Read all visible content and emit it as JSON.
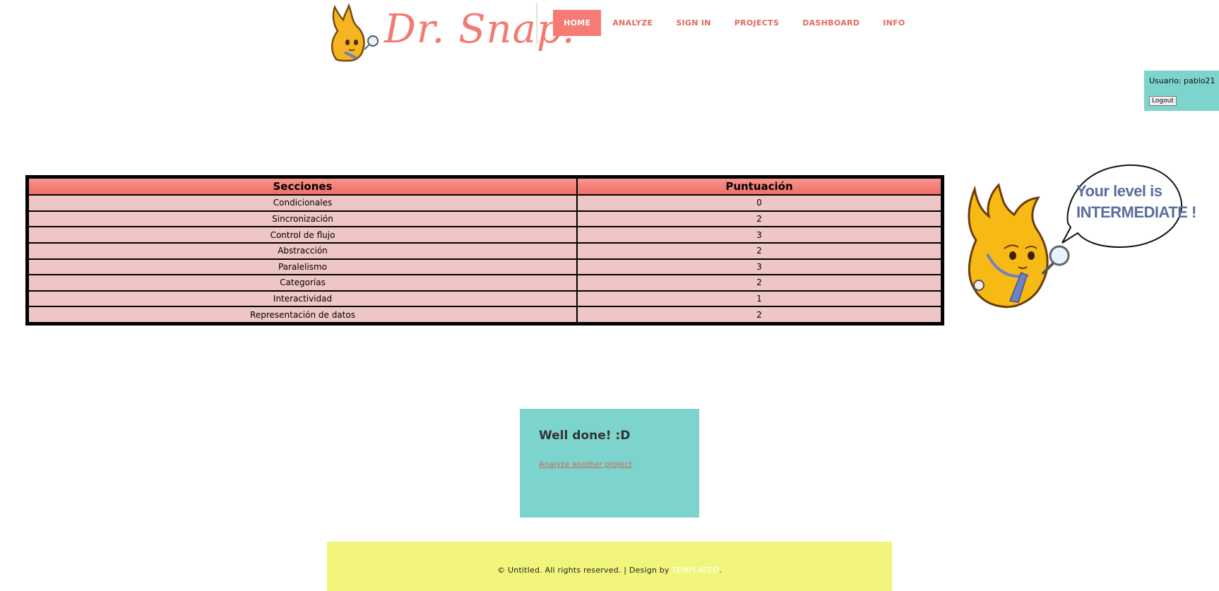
{
  "header": {
    "logo_text": "Dr. Snap!",
    "nav": [
      {
        "label": "HOME",
        "active": true
      },
      {
        "label": "ANALYZE",
        "active": false
      },
      {
        "label": "SIGN IN",
        "active": false
      },
      {
        "label": "PROJECTS",
        "active": false
      },
      {
        "label": "DASHBOARD",
        "active": false
      },
      {
        "label": "INFO",
        "active": false
      }
    ]
  },
  "user": {
    "label": "Usuario: pablo21",
    "logout_label": "Logout"
  },
  "scores": {
    "headers": [
      "Secciones",
      "Puntuación"
    ],
    "rows": [
      {
        "section": "Condicionales",
        "score": "0"
      },
      {
        "section": "Sincronización",
        "score": "2"
      },
      {
        "section": "Control de flujo",
        "score": "3"
      },
      {
        "section": "Abstracción",
        "score": "2"
      },
      {
        "section": "Paralelismo",
        "score": "3"
      },
      {
        "section": "Categorías",
        "score": "2"
      },
      {
        "section": "Interactividad",
        "score": "1"
      },
      {
        "section": "Representación de datos",
        "score": "2"
      }
    ]
  },
  "level_bubble": {
    "line1": "Your level is",
    "line2": "INTERMEDIATE !"
  },
  "result": {
    "title": "Well done! :D",
    "link_label": "Analyze another project"
  },
  "footer": {
    "text_before": "© Untitled. All rights reserved. | Design by ",
    "link_label": "TEMPLATED",
    "text_after": "."
  },
  "colors": {
    "accent": "#f67b75",
    "teal": "#7dd4cc",
    "footer_bg": "#f2f57c",
    "table_cell": "#efc6c6",
    "bubble_text": "#5a6e9e"
  },
  "icons": {
    "logo": "flame-mascot-logo",
    "mascot": "flame-mascot-magnifier"
  }
}
